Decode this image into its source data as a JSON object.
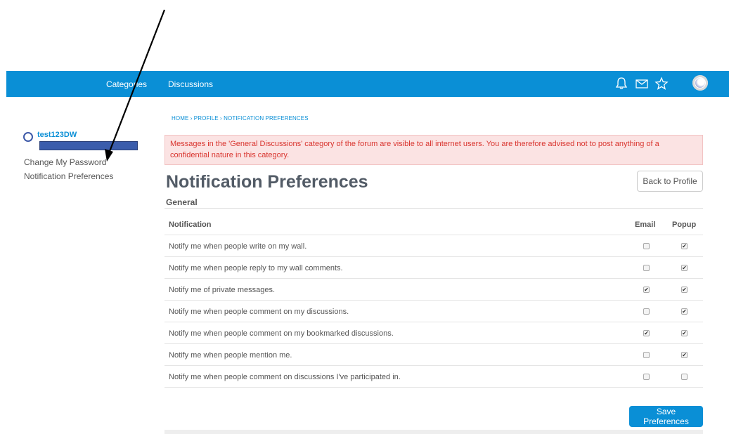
{
  "nav": {
    "categories_label": "Categories",
    "discussions_label": "Discussions",
    "icons": [
      "bell-icon",
      "mail-icon",
      "star-icon",
      "user-avatar"
    ]
  },
  "sidebar": {
    "username": "test123DW",
    "items": [
      {
        "label": "Change My Password"
      },
      {
        "label": "Notification Preferences"
      }
    ]
  },
  "breadcrumb": "HOME › PROFILE › NOTIFICATION PREFERENCES",
  "alert": "Messages in the 'General Discussions' category of the forum are visible to all internet users. You are therefore advised not to post anything of a confidential nature in this category.",
  "page_title": "Notification Preferences",
  "back_button": "Back to Profile",
  "section_title": "General",
  "table": {
    "headers": {
      "notification": "Notification",
      "email": "Email",
      "popup": "Popup"
    },
    "rows": [
      {
        "label": "Notify me when people write on my wall.",
        "email": false,
        "popup": true
      },
      {
        "label": "Notify me when people reply to my wall comments.",
        "email": false,
        "popup": true
      },
      {
        "label": "Notify me of private messages.",
        "email": true,
        "popup": true
      },
      {
        "label": "Notify me when people comment on my discussions.",
        "email": false,
        "popup": true
      },
      {
        "label": "Notify me when people comment on my bookmarked discussions.",
        "email": true,
        "popup": true
      },
      {
        "label": "Notify me when people mention me.",
        "email": false,
        "popup": true
      },
      {
        "label": "Notify me when people comment on discussions I've participated in.",
        "email": false,
        "popup": false
      }
    ]
  },
  "save_button": "Save Preferences",
  "colors": {
    "accent": "#0a8fd6",
    "alert_bg": "#fbe3e3",
    "alert_text": "#d9352f",
    "arrow": "#000000"
  }
}
